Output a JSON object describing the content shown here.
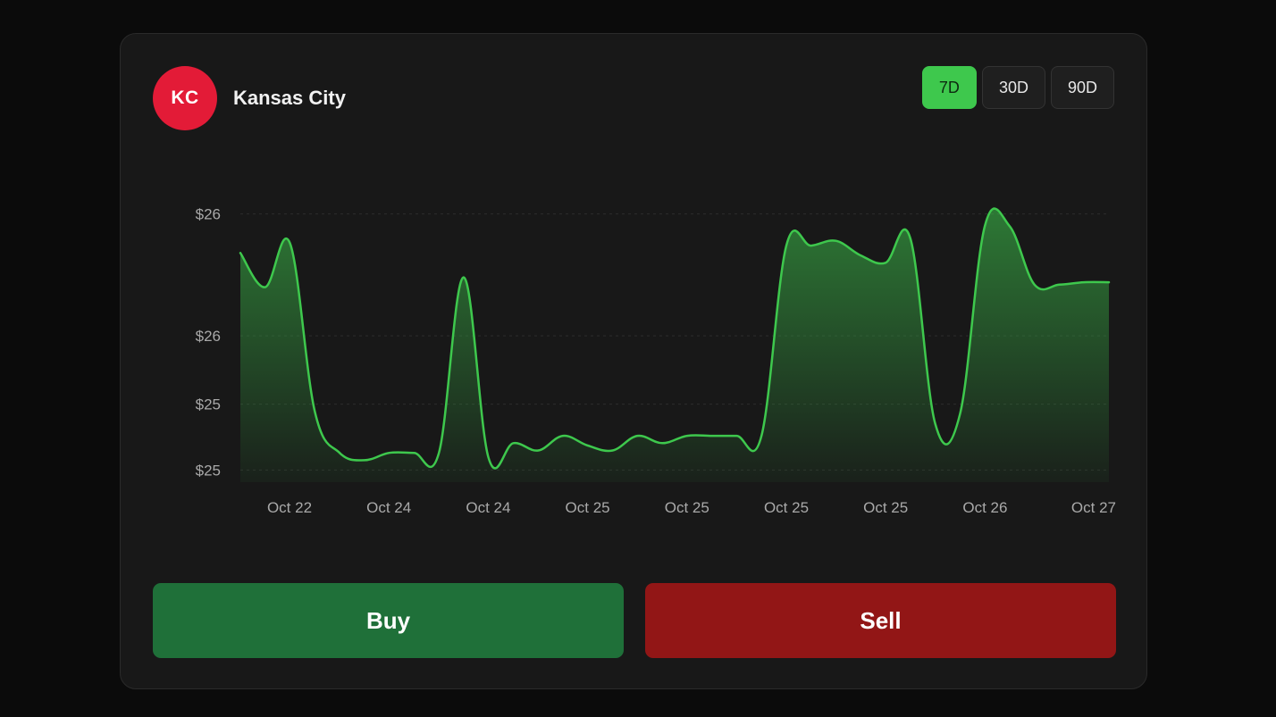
{
  "team": {
    "abbr": "KC",
    "name": "Kansas City",
    "logo_color": "#e31b37"
  },
  "ranges": [
    {
      "label": "7D",
      "active": true
    },
    {
      "label": "30D",
      "active": false
    },
    {
      "label": "90D",
      "active": false
    }
  ],
  "actions": {
    "buy_label": "Buy",
    "sell_label": "Sell"
  },
  "colors": {
    "accent": "#3ec84d",
    "buy": "#1f7039",
    "sell": "#921616"
  },
  "chart_data": {
    "type": "area",
    "title": "",
    "xlabel": "",
    "ylabel": "",
    "ylim": [
      24.9,
      26.05
    ],
    "y_ticks": [
      {
        "value": 26.0,
        "label": "$26"
      },
      {
        "value": 25.5,
        "label": "$26"
      },
      {
        "value": 25.22,
        "label": "$25"
      },
      {
        "value": 24.95,
        "label": "$25"
      }
    ],
    "x_tick_labels": [
      "Oct 22",
      "Oct 24",
      "Oct 24",
      "Oct 25",
      "Oct 25",
      "Oct 25",
      "Oct 25",
      "Oct 26",
      "Oct 27"
    ],
    "grid": true,
    "line_color": "#3ec84d",
    "series": [
      {
        "values": [
          25.84,
          25.7,
          25.88,
          25.19,
          25.02,
          24.99,
          25.02,
          25.02,
          25.02,
          25.74,
          25.0,
          25.06,
          25.03,
          25.09,
          25.05,
          25.03,
          25.09,
          25.06,
          25.09,
          25.09,
          25.09,
          25.09,
          25.87,
          25.87,
          25.89,
          25.83,
          25.8,
          25.9,
          25.14,
          25.18,
          25.95,
          25.95,
          25.71,
          25.71,
          25.72,
          25.72
        ]
      }
    ]
  }
}
